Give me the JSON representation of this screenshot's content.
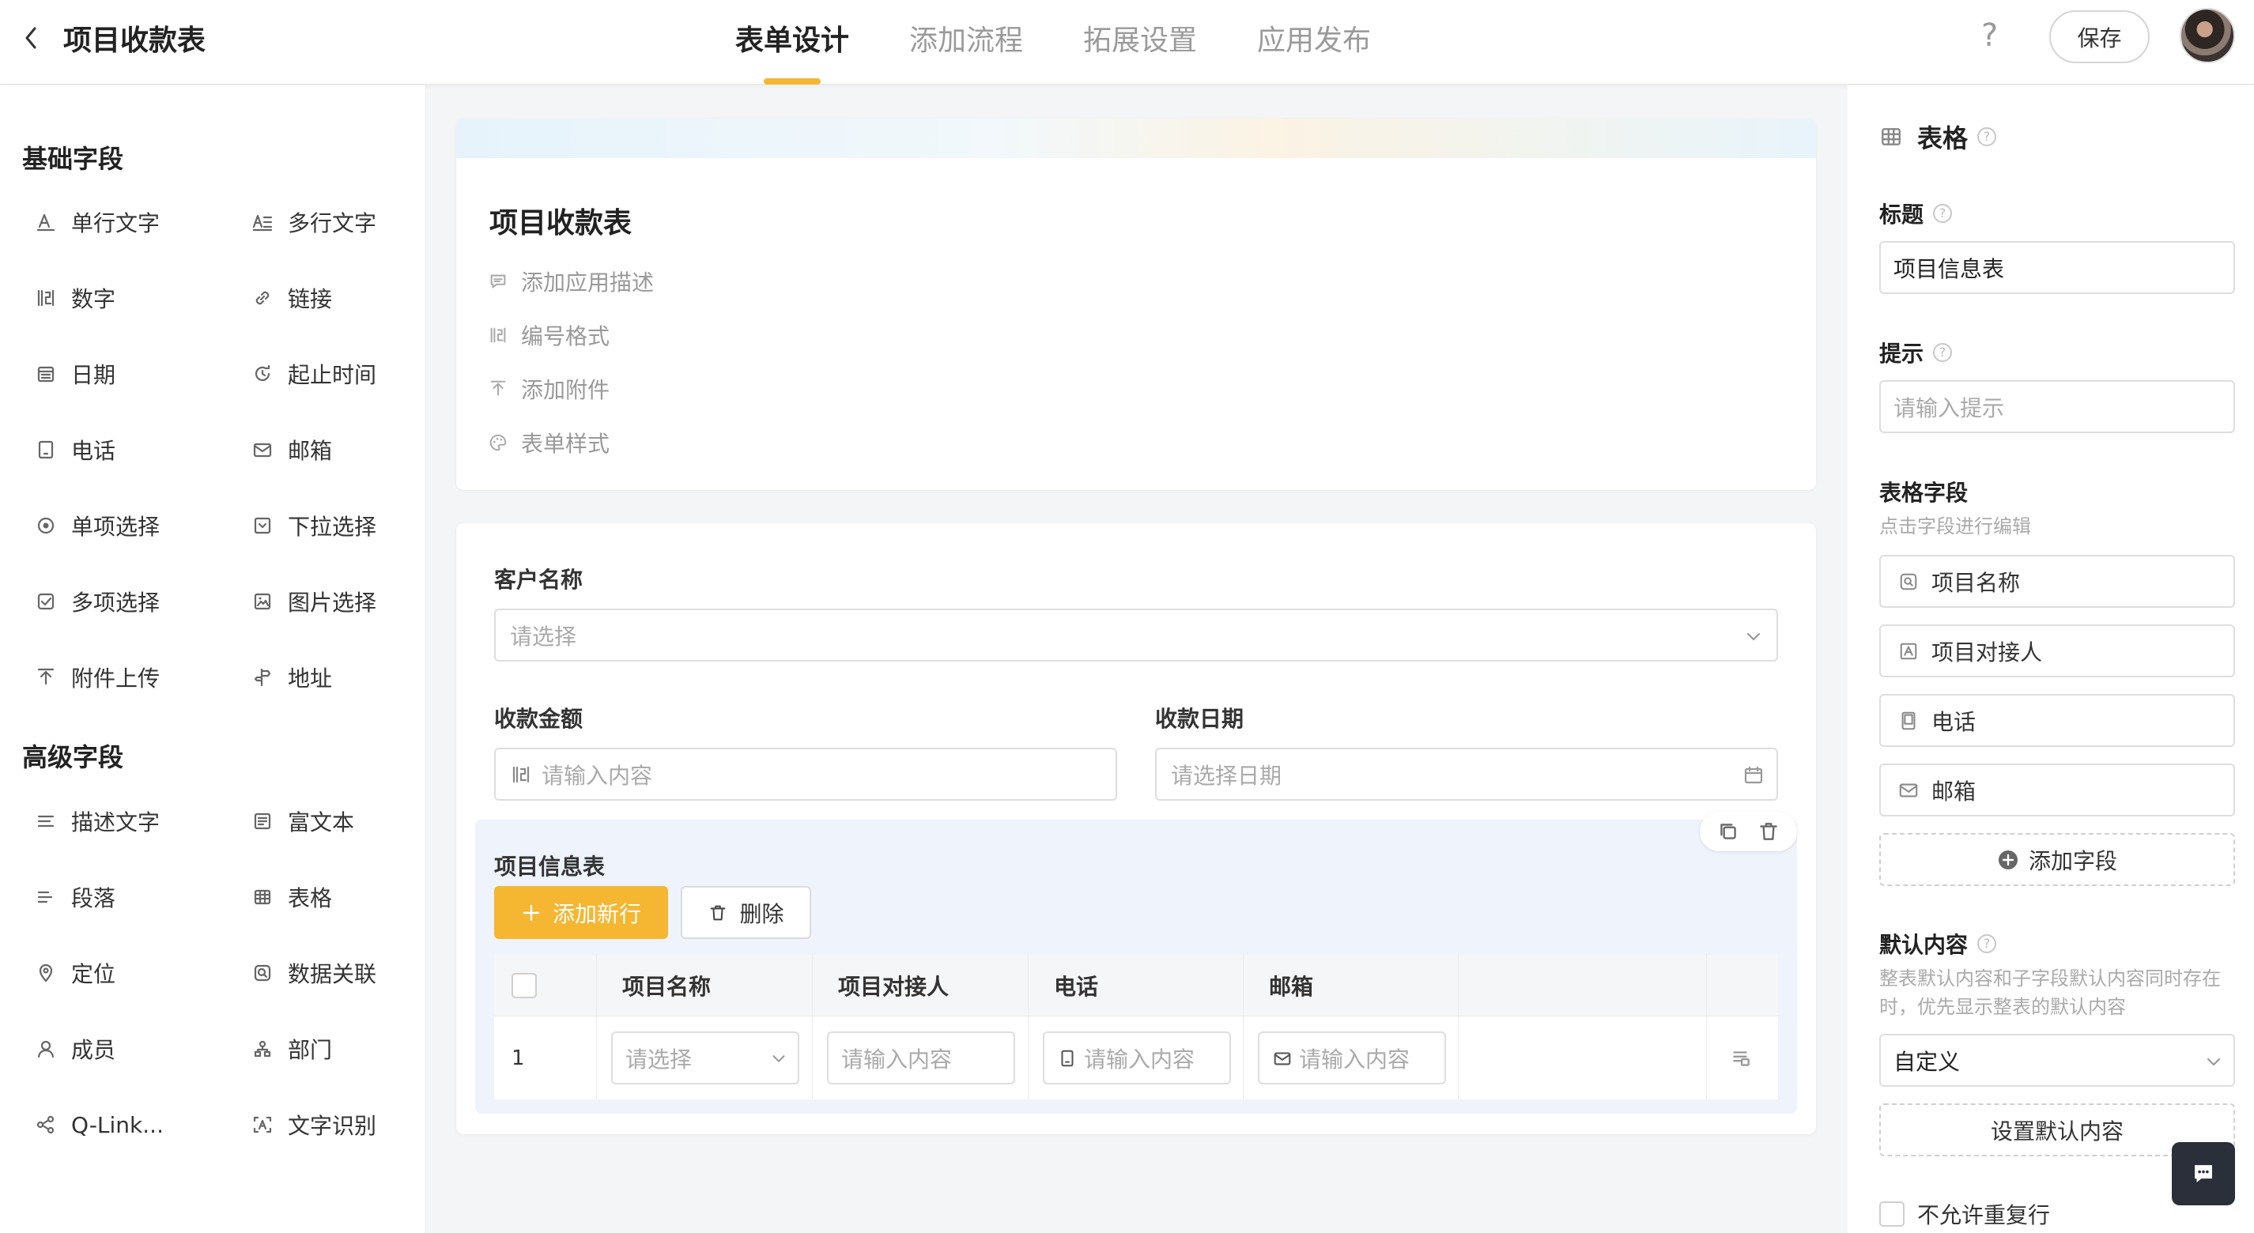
{
  "header": {
    "app_title": "项目收款表",
    "tabs": [
      {
        "label": "表单设计",
        "active": true
      },
      {
        "label": "添加流程",
        "active": false
      },
      {
        "label": "拓展设置",
        "active": false
      },
      {
        "label": "应用发布",
        "active": false
      }
    ],
    "help_label": "?",
    "save_label": "保存",
    "accent_color": "#f5b731"
  },
  "left_panel": {
    "basic_title": "基础字段",
    "basic_fields": [
      {
        "label": "单行文字",
        "icon": "single-text-icon"
      },
      {
        "label": "多行文字",
        "icon": "multi-text-icon"
      },
      {
        "label": "数字",
        "icon": "number-icon"
      },
      {
        "label": "链接",
        "icon": "link-icon"
      },
      {
        "label": "日期",
        "icon": "date-icon"
      },
      {
        "label": "起止时间",
        "icon": "time-range-icon"
      },
      {
        "label": "电话",
        "icon": "phone-icon"
      },
      {
        "label": "邮箱",
        "icon": "mail-icon"
      },
      {
        "label": "单项选择",
        "icon": "radio-icon"
      },
      {
        "label": "下拉选择",
        "icon": "dropdown-icon"
      },
      {
        "label": "多项选择",
        "icon": "checkbox-icon"
      },
      {
        "label": "图片选择",
        "icon": "image-icon"
      },
      {
        "label": "附件上传",
        "icon": "upload-icon"
      },
      {
        "label": "地址",
        "icon": "address-icon"
      }
    ],
    "advanced_title": "高级字段",
    "advanced_fields": [
      {
        "label": "描述文字",
        "icon": "description-icon"
      },
      {
        "label": "富文本",
        "icon": "rich-text-icon"
      },
      {
        "label": "段落",
        "icon": "paragraph-icon"
      },
      {
        "label": "表格",
        "icon": "table-icon"
      },
      {
        "label": "定位",
        "icon": "location-icon"
      },
      {
        "label": "数据关联",
        "icon": "data-link-icon"
      },
      {
        "label": "成员",
        "icon": "member-icon"
      },
      {
        "label": "部门",
        "icon": "department-icon"
      },
      {
        "label": "Q-Link...",
        "icon": "share-icon"
      },
      {
        "label": "文字识别",
        "icon": "ocr-icon"
      }
    ]
  },
  "form_header": {
    "title": "项目收款表",
    "items": [
      {
        "label": "添加应用描述",
        "icon": "comment-icon"
      },
      {
        "label": "编号格式",
        "icon": "number-format-icon"
      },
      {
        "label": "添加附件",
        "icon": "upload-icon"
      },
      {
        "label": "表单样式",
        "icon": "palette-icon"
      }
    ]
  },
  "form_body": {
    "customer": {
      "label": "客户名称",
      "placeholder": "请选择"
    },
    "amount": {
      "label": "收款金额",
      "placeholder": "请输入内容"
    },
    "date": {
      "label": "收款日期",
      "placeholder": "请选择日期"
    },
    "table": {
      "title": "项目信息表",
      "add_row_label": "添加新行",
      "delete_label": "删除",
      "columns": [
        "项目名称",
        "项目对接人",
        "电话",
        "邮箱"
      ],
      "rows": [
        {
          "index": "1",
          "cells": [
            "请选择",
            "请输入内容",
            "请输入内容",
            "请输入内容"
          ]
        }
      ]
    }
  },
  "right_panel": {
    "type_title": "表格",
    "title_label": "标题",
    "title_value": "项目信息表",
    "hint_label": "提示",
    "hint_placeholder": "请输入提示",
    "fields_label": "表格字段",
    "fields_hint": "点击字段进行编辑",
    "fields": [
      {
        "label": "项目名称",
        "icon": "data-link-icon"
      },
      {
        "label": "项目对接人",
        "icon": "single-text-icon"
      },
      {
        "label": "电话",
        "icon": "phone-icon"
      },
      {
        "label": "邮箱",
        "icon": "mail-icon"
      }
    ],
    "add_field_label": "添加字段",
    "default_label": "默认内容",
    "default_hint_line1": "整表默认内容和子字段默认内容同时存在",
    "default_hint_line2": "时，优先显示整表的默认内容",
    "default_select_value": "自定义",
    "set_default_label": "设置默认内容",
    "no_repeat_label": "不允许重复行"
  }
}
